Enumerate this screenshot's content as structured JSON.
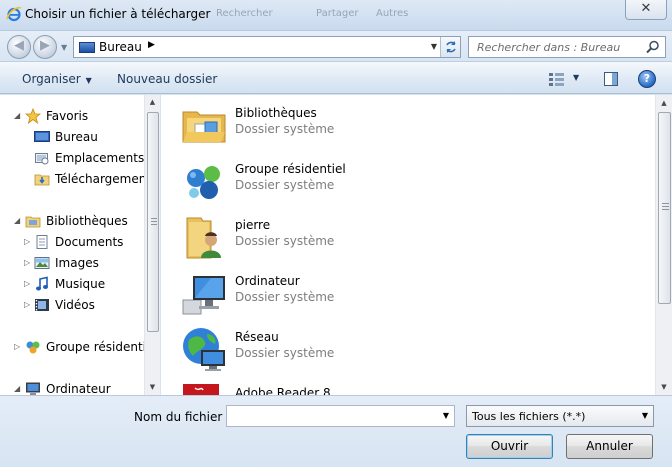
{
  "window": {
    "title": "Choisir un fichier à télécharger",
    "background_ghost": [
      "Rechercher",
      "Partager",
      "Autres"
    ]
  },
  "address": {
    "location": "Bureau",
    "search_placeholder": "Rechercher dans : Bureau"
  },
  "toolbar": {
    "organise_label": "Organiser",
    "new_folder_label": "Nouveau dossier"
  },
  "nav": {
    "favorites_label": "Favoris",
    "favorites": [
      "Bureau",
      "Emplacements récents",
      "Téléchargements"
    ],
    "libraries_label": "Bibliothèques",
    "libraries": [
      "Documents",
      "Images",
      "Musique",
      "Vidéos"
    ],
    "homegroup_label": "Groupe résidentiel",
    "computer_label": "Ordinateur"
  },
  "files": [
    {
      "name": "Bibliothèques",
      "type": "Dossier système",
      "icon": "libraries-folder-icon"
    },
    {
      "name": "Groupe résidentiel",
      "type": "Dossier système",
      "icon": "homegroup-icon"
    },
    {
      "name": "pierre",
      "type": "Dossier système",
      "icon": "user-folder-icon"
    },
    {
      "name": "Ordinateur",
      "type": "Dossier système",
      "icon": "computer-icon"
    },
    {
      "name": "Réseau",
      "type": "Dossier système",
      "icon": "network-icon"
    },
    {
      "name": "Adobe Reader 8",
      "type": "",
      "icon": "adobe-reader-icon"
    }
  ],
  "footer": {
    "filename_label": "Nom du fichier :",
    "filename_value": "",
    "filter_value": "Tous les fichiers (*.*)",
    "open_label": "Ouvrir",
    "cancel_label": "Annuler"
  }
}
